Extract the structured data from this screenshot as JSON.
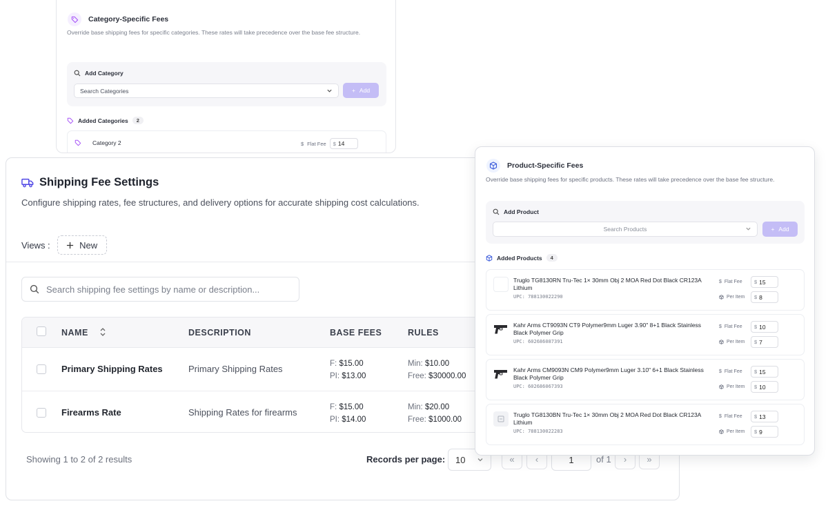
{
  "category_card": {
    "title": "Category-Specific Fees",
    "description": "Override base shipping fees for specific categories. These rates will take precedence over the base fee structure.",
    "add_label": "Add Category",
    "select_placeholder": "Search Categories",
    "add_button": "Add",
    "added_label": "Added Categories",
    "added_count": "2",
    "rows": [
      {
        "name": "Category 2",
        "flat_fee_label": "Flat Fee",
        "currency": "$",
        "flat_fee": "14"
      }
    ]
  },
  "main": {
    "title": "Shipping Fee Settings",
    "description": "Configure shipping rates, fee structures, and delivery options for accurate shipping cost calculations.",
    "views_label": "Views :",
    "new_button": "New",
    "search_placeholder": "Search shipping fee settings by name or description...",
    "columns": [
      "NAME",
      "DESCRIPTION",
      "BASE FEES",
      "RULES"
    ],
    "rows": [
      {
        "name": "Primary Shipping Rates",
        "description": "Primary Shipping Rates",
        "f_label": "F:",
        "f": "$15.00",
        "pi_label": "PI:",
        "pi": "$13.00",
        "min_label": "Min:",
        "min": "$10.00",
        "free_label": "Free:",
        "free": "$30000.00"
      },
      {
        "name": "Firearms Rate",
        "description": "Shipping Rates for firearms",
        "f_label": "F:",
        "f": "$15.00",
        "pi_label": "PI:",
        "pi": "$14.00",
        "min_label": "Min:",
        "min": "$20.00",
        "free_label": "Free:",
        "free": "$1000.00"
      }
    ],
    "footer": {
      "showing": "Showing 1 to 2 of 2 results",
      "records_per_page_label": "Records per page:",
      "records_per_page": "10",
      "first": "«",
      "prev": "‹",
      "page": "1",
      "of": "of 1",
      "next": "›",
      "last": "»"
    }
  },
  "product_card": {
    "title": "Product-Specific Fees",
    "description": "Override base shipping fees for specific products. These rates will take precedence over the base fee structure.",
    "add_label": "Add Product",
    "select_placeholder": "Search Products",
    "add_button": "Add",
    "added_label": "Added Products",
    "added_count": "4",
    "flat_fee_label": "Flat Fee",
    "per_item_label": "Per Item",
    "currency": "$",
    "products": [
      {
        "name": "Truglo TG8130RN Tru-Tec 1× 30mm Obj 2 MOA Red Dot Black CR123A Lithium",
        "upc": "UPC: 788130022290",
        "flat_fee": "15",
        "per_item": "8",
        "thumb": "empty"
      },
      {
        "name": "Kahr Arms CT9093N CT9 Polymer9mm Luger 3.90\" 8+1 Black Stainless Black Polymer Grip",
        "upc": "UPC: 602686087391",
        "flat_fee": "10",
        "per_item": "7",
        "thumb": "pistol"
      },
      {
        "name": "Kahr Arms CM9093N CM9 Polymer9mm Luger 3.10\" 6+1 Black Stainless Black Polymer Grip",
        "upc": "UPC: 602686067393",
        "flat_fee": "15",
        "per_item": "10",
        "thumb": "pistol"
      },
      {
        "name": "Truglo TG8130BN Tru-Tec 1× 30mm Obj 2 MOA Red Dot Black CR123A Lithium",
        "upc": "UPC: 788130022283",
        "flat_fee": "13",
        "per_item": "9",
        "thumb": "placeholder"
      }
    ]
  },
  "colors": {
    "accent": "#5b4be3",
    "accent_light": "#c4bdf6",
    "tag_purple": "#a855f7",
    "box_blue": "#3b5bdb"
  }
}
